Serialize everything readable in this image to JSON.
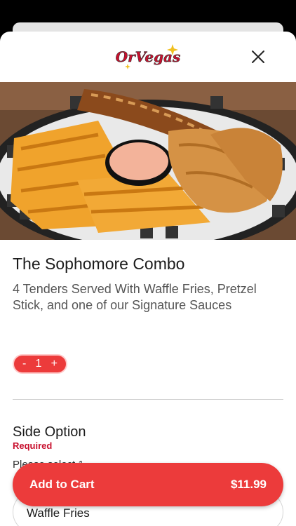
{
  "brand": {
    "logo_text": "OrVegas",
    "accent": "#ec3b3b"
  },
  "header": {
    "close_icon": "close-icon"
  },
  "item": {
    "title": "The Sophomore Combo",
    "description": "4 Tenders Served With Waffle Fries, Pretzel Stick,  and one of our Signature Sauces"
  },
  "quantity": {
    "minus": "-",
    "value": "1",
    "plus": "+"
  },
  "side_option": {
    "title": "Side Option",
    "required": "Required",
    "hint": "Please select 1",
    "options": [
      "Waffle Fries"
    ]
  },
  "cart": {
    "label": "Add to Cart",
    "price": "$11.99"
  }
}
